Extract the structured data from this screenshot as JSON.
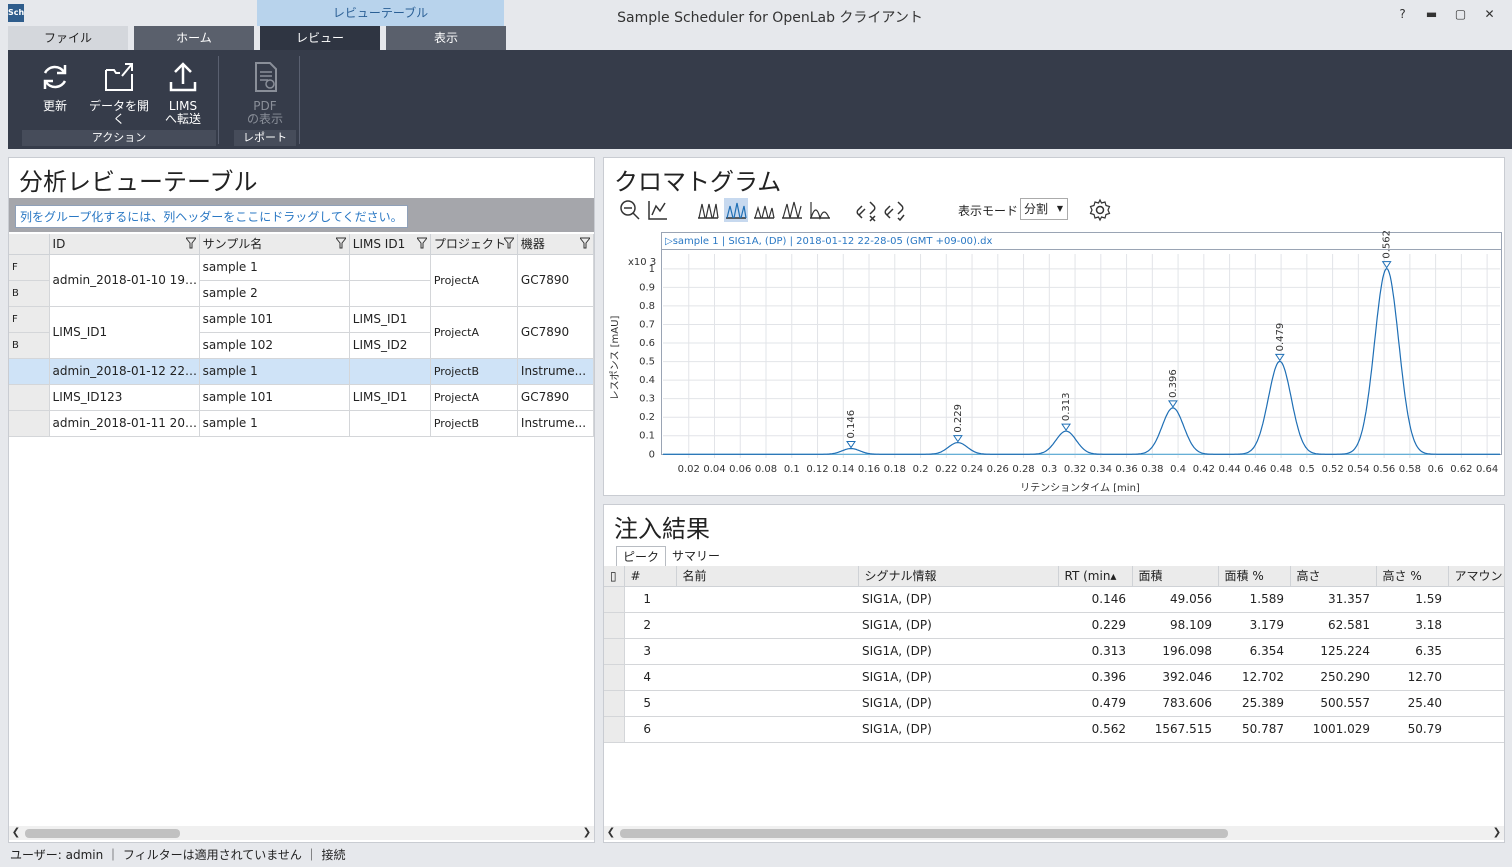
{
  "window": {
    "context_tab": "レビューテーブル",
    "title": "Sample Scheduler for OpenLab クライアント",
    "help": "?",
    "minimize": "▬",
    "maximize": "▢",
    "close": "✕"
  },
  "tabs": [
    {
      "label": "ファイル"
    },
    {
      "label": "ホーム"
    },
    {
      "label": "レビュー"
    },
    {
      "label": "表示"
    }
  ],
  "ribbon": {
    "refresh": "更新",
    "open_data": "データを開く",
    "lims_line1": "LIMS",
    "lims_line2": "へ転送",
    "pdf_line1": "PDF",
    "pdf_line2": "の表示",
    "group_action": "アクション",
    "group_report": "レポート"
  },
  "review_table": {
    "title": "分析レビューテーブル",
    "grouping_hint": "列をグループ化するには、列ヘッダーをここにドラッグしてください。",
    "columns": [
      "ID",
      "サンプル名",
      "LIMS ID1",
      "プロジェクト",
      "機器"
    ],
    "rows": [
      {
        "ind": "F",
        "id": "admin_2018-01-10 19-...",
        "sample": "sample 1",
        "lims": "",
        "project": "ProjectA",
        "instrument": "GC7890"
      },
      {
        "ind": "B",
        "sample": "sample 2",
        "lims": ""
      },
      {
        "ind": "F",
        "id": "LIMS_ID1",
        "sample": "sample 101",
        "lims": "LIMS_ID1",
        "project": "ProjectA",
        "instrument": "GC7890"
      },
      {
        "ind": "B",
        "sample": "sample 102",
        "lims": "LIMS_ID2"
      },
      {
        "ind": "",
        "id": "admin_2018-01-12 22-...",
        "sample": "sample 1",
        "lims": "",
        "project": "ProjectB",
        "instrument": "Instrume..."
      },
      {
        "ind": "",
        "id": "LIMS_ID123",
        "sample": "sample 101",
        "lims": "LIMS_ID1",
        "project": "ProjectA",
        "instrument": "GC7890"
      },
      {
        "ind": "",
        "id": "admin_2018-01-11 20-...",
        "sample": "sample 1",
        "lims": "",
        "project": "ProjectB",
        "instrument": "Instrume..."
      }
    ]
  },
  "chromatogram": {
    "title": "クロマトグラム",
    "display_mode_label": "表示モード",
    "display_mode_value": "分割",
    "header": "▷sample 1 | SIG1A, (DP) | 2018-01-12 22-28-05 (GMT +09-00).dx"
  },
  "chart_data": {
    "type": "line",
    "title": "",
    "xlabel": "リテンションタイム [min]",
    "ylabel": "レスポンス [mAU]",
    "y_multiplier": "x10 3",
    "xlim": [
      0,
      0.65
    ],
    "ylim": [
      -0.02,
      1.08
    ],
    "x_ticks": [
      "0.02",
      "0.04",
      "0.06",
      "0.08",
      "0.1",
      "0.12",
      "0.14",
      "0.16",
      "0.18",
      "0.2",
      "0.22",
      "0.24",
      "0.26",
      "0.28",
      "0.3",
      "0.32",
      "0.34",
      "0.36",
      "0.38",
      "0.4",
      "0.42",
      "0.44",
      "0.46",
      "0.48",
      "0.5",
      "0.52",
      "0.54",
      "0.56",
      "0.58",
      "0.6",
      "0.62",
      "0.64"
    ],
    "y_ticks": [
      "0",
      "0.1",
      "0.2",
      "0.3",
      "0.4",
      "0.5",
      "0.6",
      "0.7",
      "0.8",
      "0.9",
      "1"
    ],
    "grid": true,
    "peaks": [
      {
        "rt": 0.146,
        "height": 0.031,
        "label": "0.146"
      },
      {
        "rt": 0.229,
        "height": 0.063,
        "label": "0.229"
      },
      {
        "rt": 0.313,
        "height": 0.125,
        "label": "0.313"
      },
      {
        "rt": 0.396,
        "height": 0.25,
        "label": "0.396"
      },
      {
        "rt": 0.479,
        "height": 0.501,
        "label": "0.479"
      },
      {
        "rt": 0.562,
        "height": 1.001,
        "label": "0.562"
      }
    ],
    "line_color": "#1f6fb5",
    "baseline_color": "#4aa8d8"
  },
  "injection": {
    "title": "注入結果",
    "tabs": [
      "ピーク",
      "サマリー"
    ],
    "columns": [
      "#",
      "名前",
      "シグナル情報",
      "RT (min▴",
      "面積",
      "面積 %",
      "高さ",
      "高さ %",
      "アマウント"
    ],
    "rows": [
      {
        "n": "1",
        "name": "",
        "signal": "SIG1A, (DP)",
        "rt": "0.146",
        "area": "49.056",
        "area_pct": "1.589",
        "height": "31.357",
        "height_pct": "1.59"
      },
      {
        "n": "2",
        "name": "",
        "signal": "SIG1A, (DP)",
        "rt": "0.229",
        "area": "98.109",
        "area_pct": "3.179",
        "height": "62.581",
        "height_pct": "3.18"
      },
      {
        "n": "3",
        "name": "",
        "signal": "SIG1A, (DP)",
        "rt": "0.313",
        "area": "196.098",
        "area_pct": "6.354",
        "height": "125.224",
        "height_pct": "6.35"
      },
      {
        "n": "4",
        "name": "",
        "signal": "SIG1A, (DP)",
        "rt": "0.396",
        "area": "392.046",
        "area_pct": "12.702",
        "height": "250.290",
        "height_pct": "12.70"
      },
      {
        "n": "5",
        "name": "",
        "signal": "SIG1A, (DP)",
        "rt": "0.479",
        "area": "783.606",
        "area_pct": "25.389",
        "height": "500.557",
        "height_pct": "25.40"
      },
      {
        "n": "6",
        "name": "",
        "signal": "SIG1A, (DP)",
        "rt": "0.562",
        "area": "1567.515",
        "area_pct": "50.787",
        "height": "1001.029",
        "height_pct": "50.79"
      }
    ]
  },
  "status": {
    "text": "ユーザー: admin ｜ フィルターは適用されていません ｜ 接続"
  }
}
